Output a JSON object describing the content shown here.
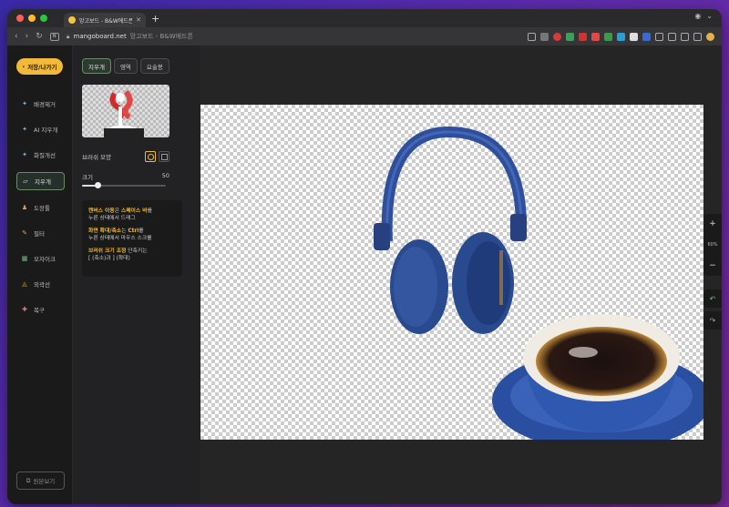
{
  "browser": {
    "tab_title": "망고보드 - B&W에드픈",
    "new_tab": "+",
    "url_host": "mangoboard.net",
    "url_sub": "망고보드 - B&W에드픈"
  },
  "sidebar": {
    "back_label": "저장/나가기",
    "tools": [
      {
        "label": "배경제거",
        "icon": "ai-bg-remove-icon"
      },
      {
        "label": "AI 지우개",
        "icon": "ai-eraser-icon"
      },
      {
        "label": "화질개선",
        "icon": "ai-upscale-icon"
      },
      {
        "label": "지우개",
        "icon": "eraser-icon"
      },
      {
        "label": "도장툴",
        "icon": "stamp-icon"
      },
      {
        "label": "필터",
        "icon": "filter-icon"
      },
      {
        "label": "모자이크",
        "icon": "mosaic-icon"
      },
      {
        "label": "외곽선",
        "icon": "outline-icon"
      },
      {
        "label": "복구",
        "icon": "restore-icon"
      }
    ],
    "original_label": "원본보기"
  },
  "panel": {
    "tabs": [
      "지우개",
      "영역",
      "요술봉"
    ],
    "brush_shape_label": "브러쉬 모양",
    "size_label": "크기",
    "size_value": "50",
    "size_fraction": 0.18,
    "help": [
      {
        "strong": "캔버스 이동",
        "mid": "은 ",
        "strong2": "스페이스 바",
        "rest": "를",
        "line2": "누른 상태에서 드래그"
      },
      {
        "strong": "화면 확대/축소",
        "mid": "는 ",
        "strong2": "Ctrl",
        "rest": "를",
        "line2": "누른 상태에서 마우스 스크롤"
      },
      {
        "strong": "브러쉬 크기 조정",
        "mid": " 단축키는",
        "strong2": "",
        "rest": "",
        "line2": "[ (축소)과 ] (확대)"
      }
    ]
  },
  "workspace": {
    "zoom_in": "+",
    "zoom_value": "60%",
    "zoom_out": "−",
    "undo": "↶",
    "redo": "↷"
  },
  "colors": {
    "accent": "#f2b93b",
    "active_border": "#6a8a6a",
    "headphone_blue": "#2f4f9a"
  }
}
